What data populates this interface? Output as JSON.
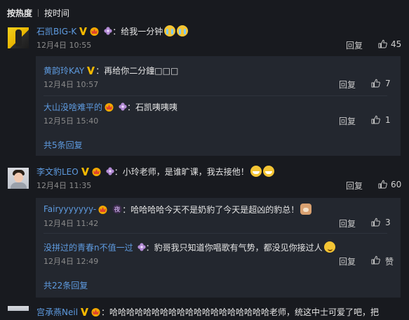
{
  "tabs": [
    "按热度",
    "按时间"
  ],
  "comments": [
    {
      "user": "石凯BIG-K",
      "text": "：给我一分钟",
      "time": "12月4日 10:55",
      "reply_label": "回复",
      "likes": "45",
      "replies": [
        {
          "user": "黄韵玲KAY",
          "text": "：再给你二分鐘□□□",
          "time": "12月4日 10:57",
          "reply_label": "回复",
          "likes": "7"
        },
        {
          "user": "大山没啥难平的",
          "text": "：石凯咦咦咦",
          "time": "12月5日 15:40",
          "reply_label": "回复",
          "likes": "1"
        }
      ],
      "more_label": "共5条回复"
    },
    {
      "user": "李文豹LEO",
      "text": "：小玲老师，是谁旷课，我去接他！",
      "time": "12月4日 11:35",
      "reply_label": "回复",
      "likes": "60",
      "replies": [
        {
          "user": "Fairyyyyyyy-",
          "text": "：哈哈哈哈今天不是奶豹了今天是超凶的豹总！",
          "time": "12月4日 11:42",
          "reply_label": "回复",
          "likes": "3"
        },
        {
          "user": "没拼过的青春n不值一过",
          "text": "：豹哥我只知道你唱歌有气势，都没见你接过人",
          "time": "12月4日 12:49",
          "reply_label": "回复",
          "likes": "赞"
        }
      ],
      "more_label": "共22条回复"
    },
    {
      "user": "宫承燕Neil",
      "text": "：哈哈哈哈哈哈哈哈哈哈哈哈哈哈哈哈哈哈哈老师，统这中士可爱了吧，把"
    }
  ],
  "icons": {
    "verified": "verified-v-icon",
    "crown": "crown-badge-icon",
    "flower": "flower-badge-icon",
    "like": "thumbs-up-icon"
  },
  "colors": {
    "background": "#181a1f",
    "reply_box": "#23272f",
    "link": "#5e9be0",
    "verified": "#f5b800"
  }
}
